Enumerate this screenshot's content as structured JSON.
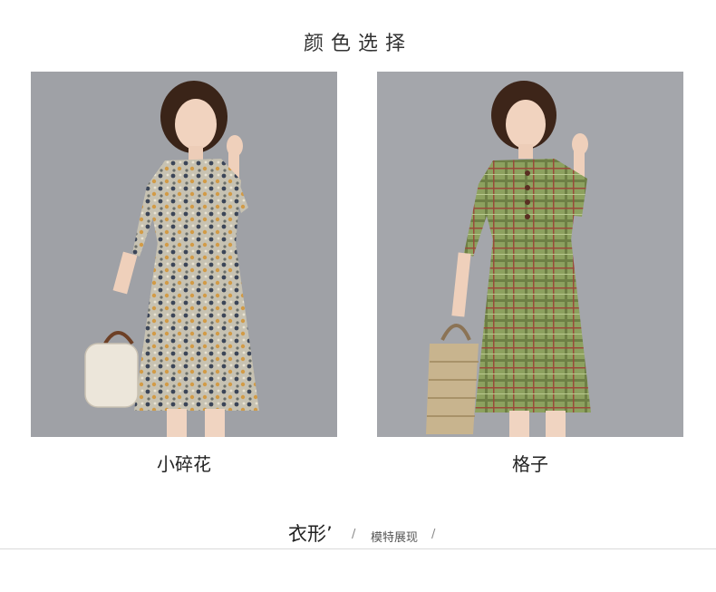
{
  "section_title": "颜色选择",
  "products": [
    {
      "caption": "小碎花",
      "background": "#9fa1a6",
      "dress_color": "#b8b4a6",
      "pattern": "floral"
    },
    {
      "caption": "格子",
      "background": "#a4a6ab",
      "dress_color": "#8da15f",
      "pattern": "plaid"
    }
  ],
  "footer": {
    "title": "衣形’",
    "subtitle": "模特展现",
    "divider": "/"
  }
}
